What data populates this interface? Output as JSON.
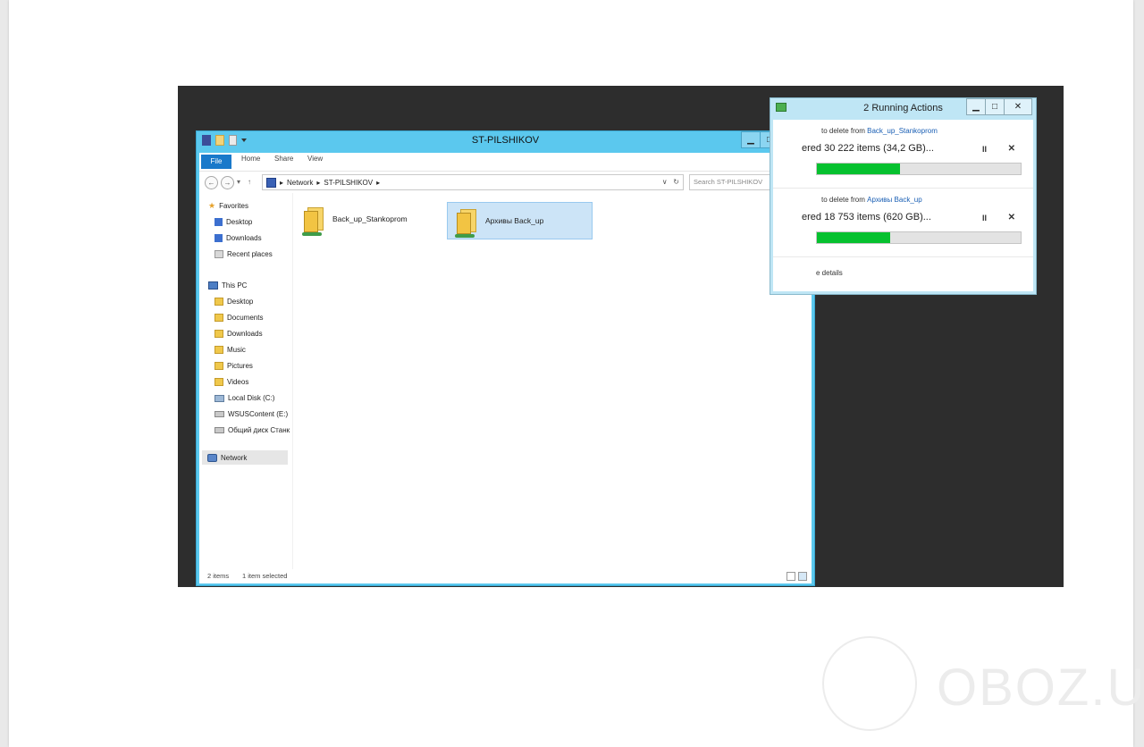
{
  "explorer": {
    "title": "ST-PILSHIKOV",
    "window_controls": [
      "▁",
      "□",
      "✕"
    ],
    "ribbon": {
      "tabs": [
        "File",
        "Home",
        "Share",
        "View"
      ],
      "expand": "∨",
      "help": "?"
    },
    "nav": {
      "back": "←",
      "forward": "→",
      "recent": "▾",
      "up": "↑"
    },
    "address": {
      "crumbs": [
        "▸",
        "Network",
        "▸",
        "ST-PILSHIKOV",
        "▸"
      ],
      "dropdown": "∨",
      "refresh": "↻"
    },
    "search": {
      "placeholder": "Search ST-PILSHIKOV",
      "icon": "⌕"
    },
    "sidebar": {
      "favorites": {
        "label": "Favorites",
        "items": [
          "Desktop",
          "Downloads",
          "Recent places"
        ]
      },
      "this_pc": {
        "label": "This PC",
        "items": [
          "Desktop",
          "Documents",
          "Downloads",
          "Music",
          "Pictures",
          "Videos",
          "Local Disk (C:)",
          "WSUSContent (E:)",
          "Общий диск Станк"
        ]
      },
      "network": {
        "label": "Network"
      }
    },
    "files": [
      {
        "name": "Back_up_Stankoprom",
        "selected": false
      },
      {
        "name": "Архивы Back_up",
        "selected": true
      }
    ],
    "status": {
      "count": "2 items",
      "selection": "1 item selected"
    }
  },
  "dialog": {
    "title": "2 Running Actions",
    "controls": [
      "▁",
      "□",
      "✕"
    ],
    "operations": [
      {
        "prefix": "to delete from ",
        "source": "Back_up_Stankoprom",
        "progress_text": "ered 30 222 items (34,2 GB)...",
        "progress": 0.41,
        "pause": "II",
        "cancel": "✕"
      },
      {
        "prefix": "to delete from ",
        "source": "Архивы Back_up",
        "progress_text": "ered 18 753 items (620 GB)...",
        "progress": 0.36,
        "pause": "II",
        "cancel": "✕"
      }
    ],
    "details": "e details"
  },
  "watermark": {
    "text": "OBOZ.UA"
  },
  "colors": {
    "explorer_frame": "#5bc8ee",
    "close_button": "#c9432b",
    "file_tab": "#1979ca",
    "progress_fill": "#06c12f",
    "selection": "#cce4f7"
  }
}
